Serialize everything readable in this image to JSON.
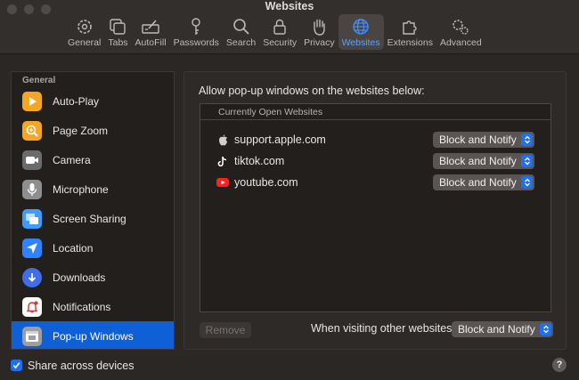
{
  "window": {
    "title": "Websites"
  },
  "toolbar": {
    "items": [
      {
        "label": "General",
        "icon": "gear-icon"
      },
      {
        "label": "Tabs",
        "icon": "tabs-icon"
      },
      {
        "label": "AutoFill",
        "icon": "autofill-icon"
      },
      {
        "label": "Passwords",
        "icon": "key-icon"
      },
      {
        "label": "Search",
        "icon": "search-icon"
      },
      {
        "label": "Security",
        "icon": "lock-icon"
      },
      {
        "label": "Privacy",
        "icon": "hand-icon"
      },
      {
        "label": "Websites",
        "icon": "globe-icon",
        "active": true
      },
      {
        "label": "Extensions",
        "icon": "puzzle-icon"
      },
      {
        "label": "Advanced",
        "icon": "gears-icon"
      }
    ]
  },
  "sidebar": {
    "header": "General",
    "items": [
      {
        "label": "Auto-Play",
        "icon": "play-icon",
        "color": "#f5a623"
      },
      {
        "label": "Page Zoom",
        "icon": "zoom-icon",
        "color": "#f5a623"
      },
      {
        "label": "Camera",
        "icon": "camera-icon",
        "color": "#6b6b6b"
      },
      {
        "label": "Microphone",
        "icon": "microphone-icon",
        "color": "#8e8e8e"
      },
      {
        "label": "Screen Sharing",
        "icon": "screen-sharing-icon",
        "color": "#3e9bff"
      },
      {
        "label": "Location",
        "icon": "location-arrow-icon",
        "color": "#2f83ff"
      },
      {
        "label": "Downloads",
        "icon": "download-icon",
        "color": "#3e6fe8"
      },
      {
        "label": "Notifications",
        "icon": "bell-icon",
        "color": "#ffffff"
      },
      {
        "label": "Pop-up Windows",
        "icon": "popup-window-icon",
        "color": "#9e9e9e",
        "selected": true
      }
    ]
  },
  "main": {
    "title": "Allow pop-up windows on the websites below:",
    "table_header": "Currently Open Websites",
    "rows": [
      {
        "site": "support.apple.com",
        "icon": "apple-logo-icon",
        "setting": "Block and Notify"
      },
      {
        "site": "tiktok.com",
        "icon": "tiktok-logo-icon",
        "setting": "Block and Notify"
      },
      {
        "site": "youtube.com",
        "icon": "youtube-logo-icon",
        "setting": "Block and Notify"
      }
    ],
    "remove_label": "Remove",
    "other_label": "When visiting other websites:",
    "other_setting": "Block and Notify"
  },
  "footer": {
    "share_label": "Share across devices",
    "share_checked": true,
    "help_label": "?"
  },
  "colors": {
    "accent": "#1f6ff0",
    "selected": "#0f5fd6"
  }
}
